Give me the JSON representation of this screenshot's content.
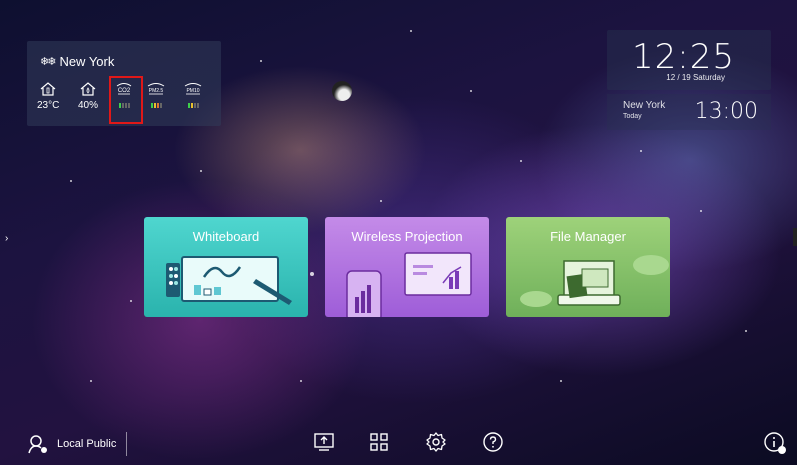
{
  "weather": {
    "city": "New York",
    "weather_icon": "snow-icon",
    "temperature": "23°C",
    "humidity": "40%",
    "sensors": [
      {
        "label": "CO2",
        "icon": "co2-icon",
        "level_colors": [
          "#3ecf4b",
          "#666666",
          "#666666",
          "#666666"
        ]
      },
      {
        "label": "PM2.5",
        "icon": "pm25-icon",
        "level_colors": [
          "#3ecf4b",
          "#e7c12e",
          "#e07a2e",
          "#666666"
        ]
      },
      {
        "label": "PM10",
        "icon": "pm10-icon",
        "level_colors": [
          "#3ecf4b",
          "#e7c12e",
          "#666666",
          "#666666"
        ]
      }
    ]
  },
  "clock": {
    "time": "12:25",
    "date": "12 / 19 Saturday"
  },
  "world_clock": {
    "city": "New York",
    "day": "Today",
    "time": "13:00"
  },
  "apps": [
    {
      "label": "Whiteboard",
      "color": "#34c3bd"
    },
    {
      "label": "Wireless Projection",
      "color": "#b073e0"
    },
    {
      "label": "File Manager",
      "color": "#86c36a"
    }
  ],
  "bottom_bar": {
    "user_label": "Local Public",
    "icons": [
      "screen-share-icon",
      "app-grid-icon",
      "settings-gear-icon",
      "help-icon"
    ],
    "info_icon": "system-info-icon"
  }
}
